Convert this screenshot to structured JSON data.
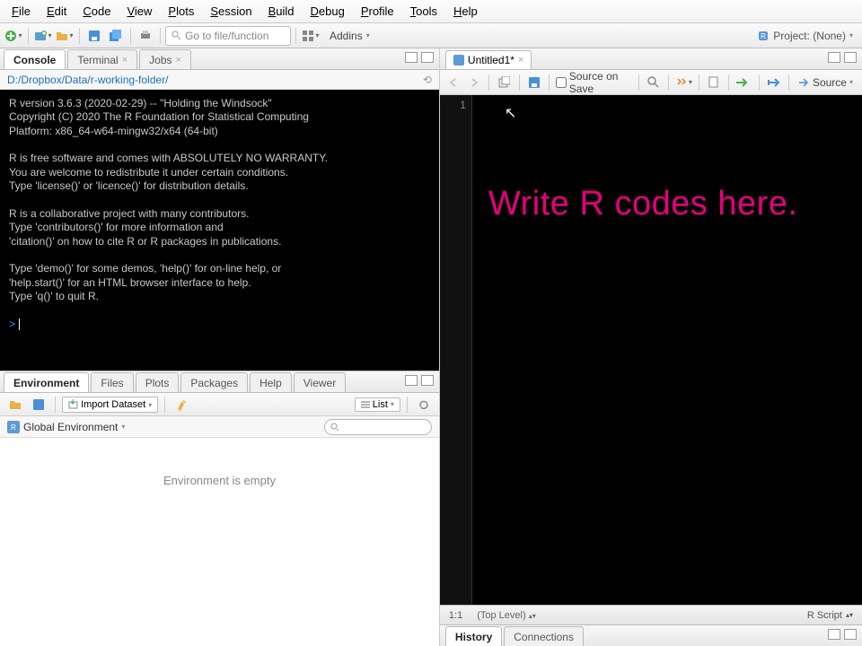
{
  "menu": [
    "File",
    "Edit",
    "Code",
    "View",
    "Plots",
    "Session",
    "Build",
    "Debug",
    "Profile",
    "Tools",
    "Help"
  ],
  "toolbar": {
    "goto_placeholder": "Go to file/function",
    "addins": "Addins",
    "project": "Project: (None)"
  },
  "left_top": {
    "tabs": [
      "Console",
      "Terminal",
      "Jobs"
    ],
    "active": 0,
    "path": "D:/Dropbox/Data/r-working-folder/",
    "console_text": "R version 3.6.3 (2020-02-29) -- \"Holding the Windsock\"\nCopyright (C) 2020 The R Foundation for Statistical Computing\nPlatform: x86_64-w64-mingw32/x64 (64-bit)\n\nR is free software and comes with ABSOLUTELY NO WARRANTY.\nYou are welcome to redistribute it under certain conditions.\nType 'license()' or 'licence()' for distribution details.\n\nR is a collaborative project with many contributors.\nType 'contributors()' for more information and\n'citation()' on how to cite R or R packages in publications.\n\nType 'demo()' for some demos, 'help()' for on-line help, or\n'help.start()' for an HTML browser interface to help.\nType 'q()' to quit R.\n",
    "prompt": ">"
  },
  "left_bottom": {
    "tabs": [
      "Environment",
      "Files",
      "Plots",
      "Packages",
      "Help",
      "Viewer"
    ],
    "active": 0,
    "import_label": "Import Dataset",
    "list_label": "List",
    "scope": "Global Environment",
    "empty_msg": "Environment is empty"
  },
  "editor": {
    "tab_title": "Untitled1*",
    "source_on_save": "Source on Save",
    "source_btn": "Source",
    "line_num": "1",
    "overlay": "Write R codes here.",
    "status_pos": "1:1",
    "status_scope": "(Top Level)",
    "status_lang": "R Script"
  },
  "right_bottom": {
    "tabs": [
      "History",
      "Connections"
    ],
    "active": 0
  }
}
